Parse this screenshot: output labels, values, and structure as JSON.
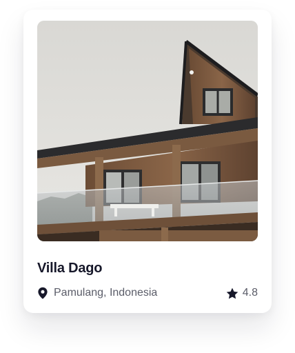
{
  "card": {
    "title": "Villa Dago",
    "location": "Pamulang, Indonesia",
    "rating": "4.8",
    "location_icon": "map-pin-icon",
    "rating_icon": "star-icon",
    "photo_subject": "wooden-villa-photo"
  },
  "colors": {
    "title": "#17182a",
    "meta_text": "#5a5c68",
    "icon": "#17182a",
    "card_bg": "#ffffff"
  }
}
